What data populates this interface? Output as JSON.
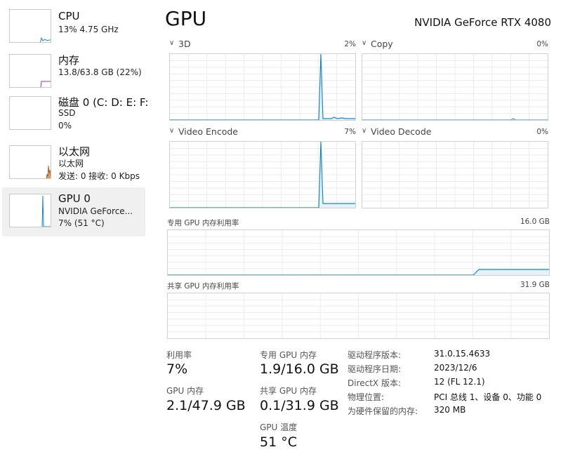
{
  "sidebar": {
    "items": [
      {
        "title": "CPU",
        "lines": [
          "13% 4.75 GHz"
        ],
        "color": "#1a86c8"
      },
      {
        "title": "内存",
        "lines": [
          "13.8/63.8 GB (22%)"
        ],
        "color": "#8b3aa8"
      },
      {
        "title": "磁盘 0 (C: D: E: F:",
        "lines": [
          "SSD",
          "0%"
        ],
        "color": "#4c9a2a"
      },
      {
        "title": "以太网",
        "lines": [
          "以太网",
          "发送: 0 接收: 0 Kbps"
        ],
        "color": "#a7510f"
      },
      {
        "title": "GPU 0",
        "lines": [
          "NVIDIA GeForce...",
          "7% (51 °C)"
        ],
        "color": "#1a86c8"
      }
    ]
  },
  "header": {
    "title": "GPU",
    "device": "NVIDIA GeForce RTX 4080"
  },
  "engines": [
    {
      "name": "3D",
      "percent": "2%"
    },
    {
      "name": "Copy",
      "percent": "0%"
    },
    {
      "name": "Video Encode",
      "percent": "7%"
    },
    {
      "name": "Video Decode",
      "percent": "0%"
    }
  ],
  "memory_graphs": {
    "dedicated": {
      "label": "专用 GPU 内存利用率",
      "capacity": "16.0 GB"
    },
    "shared": {
      "label": "共享 GPU 内存利用率",
      "capacity": "31.9 GB"
    }
  },
  "stats": {
    "utilization": {
      "label": "利用率",
      "value": "7%"
    },
    "gpu_memory": {
      "label": "GPU 内存",
      "value": "2.1/47.9 GB"
    },
    "dedicated_memory": {
      "label": "专用 GPU 内存",
      "value": "1.9/16.0 GB"
    },
    "shared_memory": {
      "label": "共享 GPU 内存",
      "value": "0.1/31.9 GB"
    },
    "temperature": {
      "label": "GPU 温度",
      "value": "51 °C"
    }
  },
  "info": [
    {
      "label": "驱动程序版本:",
      "value": "31.0.15.4633"
    },
    {
      "label": "驱动程序日期:",
      "value": "2023/12/6"
    },
    {
      "label": "DirectX 版本:",
      "value": "12 (FL 12.1)"
    },
    {
      "label": "物理位置:",
      "value": "PCI 总线 1、设备 0、功能 0"
    },
    {
      "label": "为硬件保留的内存:",
      "value": "320 MB"
    }
  ],
  "colors": {
    "gpu_line": "#1a86c8",
    "gpu_fill": "#e6f1fa",
    "grid": "#ececec",
    "selected_bg": "#f0f0f0"
  }
}
